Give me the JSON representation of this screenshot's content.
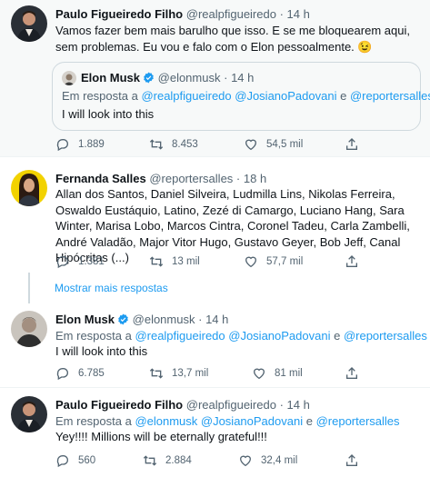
{
  "tweets": [
    {
      "name": "Paulo Figueiredo Filho",
      "handle": "@realpfigueiredo",
      "time": "14 h",
      "text": "Vamos fazer bem mais barulho que isso. E se me bloquearem aqui, sem problemas. Eu vou e falo com o Elon pessoalmente. 😉",
      "quote": {
        "name": "Elon Musk",
        "handle": "@elonmusk",
        "time": "14 h",
        "reply_prefix": "Em resposta a ",
        "reply_to": "@realpfigueiredo @JosianoPadovani",
        "reply_and": " e ",
        "reply_last": "@reportersalles",
        "text": "I will look into this"
      },
      "stats": {
        "replies": "1.889",
        "retweets": "8.453",
        "likes": "54,5 mil"
      }
    },
    {
      "name": "Fernanda Salles",
      "handle": "@reportersalles",
      "time": "18 h",
      "text": "Allan dos Santos, Daniel Silveira, Ludmilla Lins, Nikolas Ferreira, Oswaldo Eustáquio, Latino, Zezé di Camargo, Luciano Hang, Sara Winter, Marisa Lobo, Marcos Cintra, Coronel Tadeu, Carla Zambelli, André Valadão, Major Vitor Hugo, Gustavo Geyer, Bob Jeff, Canal Hipócritas (...)",
      "stats": {
        "replies": "1.381",
        "retweets": "13 mil",
        "likes": "57,7 mil"
      }
    },
    {
      "name": "Elon Musk",
      "handle": "@elonmusk",
      "time": "14 h",
      "reply_prefix": "Em resposta a ",
      "reply_to": "@realpfigueiredo @JosianoPadovani",
      "reply_and": " e ",
      "reply_last": "@reportersalles",
      "text": "I will look into this",
      "stats": {
        "replies": "6.785",
        "retweets": "13,7 mil",
        "likes": "81 mil"
      }
    },
    {
      "name": "Paulo Figueiredo Filho",
      "handle": "@realpfigueiredo",
      "time": "14 h",
      "reply_prefix": "Em resposta a ",
      "reply_to": "@elonmusk @JosianoPadovani",
      "reply_and": " e ",
      "reply_last": "@reportersalles",
      "text": "Yey!!!! Millions will be eternally grateful!!!",
      "stats": {
        "replies": "560",
        "retweets": "2.884",
        "likes": "32,4 mil"
      }
    }
  ],
  "show_more": "Mostrar mais respostas",
  "colors": {
    "accent": "#1d9bf0",
    "muted": "#536471",
    "text": "#0f1419",
    "border": "#cfd9de",
    "highlight_bg": "#f7f9f9"
  },
  "icons": [
    "reply-icon",
    "retweet-icon",
    "like-icon",
    "share-icon",
    "verified-badge-icon"
  ]
}
